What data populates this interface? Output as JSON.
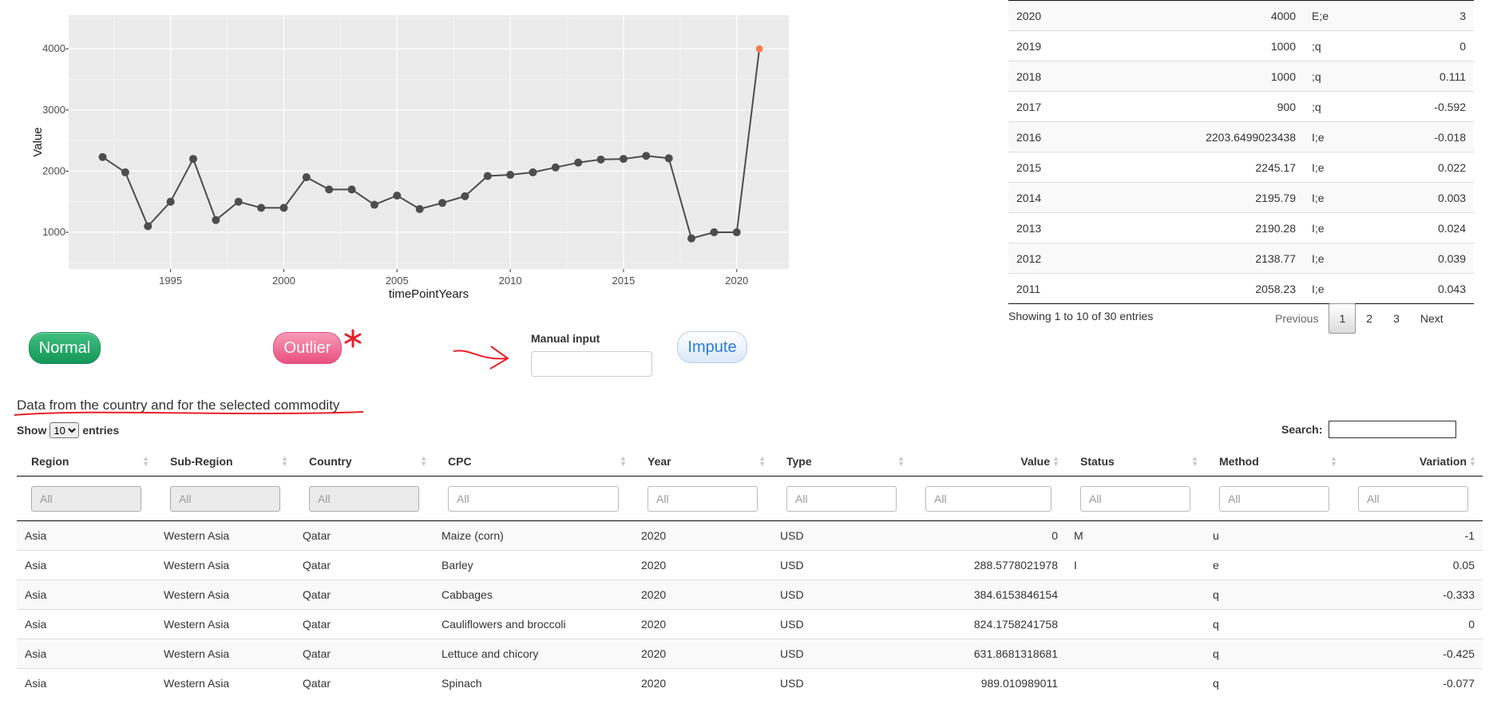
{
  "chart_data": {
    "type": "line",
    "xlabel": "timePointYears",
    "ylabel": "Value",
    "xlim": [
      1990.5,
      2022.3
    ],
    "ylim": [
      400,
      4550
    ],
    "xticks": [
      1995,
      2000,
      2005,
      2010,
      2015,
      2020
    ],
    "yticks": [
      1000,
      2000,
      3000,
      4000
    ],
    "x": [
      1992,
      1993,
      1994,
      1995,
      1996,
      1997,
      1998,
      1999,
      2000,
      2001,
      2002,
      2003,
      2004,
      2005,
      2006,
      2007,
      2008,
      2009,
      2010,
      2011,
      2012,
      2013,
      2014,
      2015,
      2016,
      2017,
      2018,
      2019,
      2020,
      2021
    ],
    "series": [
      {
        "values": [
          2230,
          1980,
          1100,
          1500,
          2200,
          1200,
          1500,
          1400,
          1400,
          1900,
          1700,
          1700,
          1450,
          1600,
          1380,
          1480,
          1590,
          1920,
          1940,
          1980,
          2060,
          2140,
          2190,
          2200,
          2250,
          2210,
          900,
          1000,
          1000,
          4000
        ],
        "highlight_index": 29
      }
    ],
    "grid": true,
    "colors": {
      "line": "#4d4d4d",
      "point": "#4d4d4d",
      "highlight": "#ff7f50",
      "panel": "#ebebeb",
      "gridline": "#ffffff"
    }
  },
  "buttons": {
    "normal": "Normal",
    "outlier": "Outlier",
    "impute": "Impute"
  },
  "manual_input": {
    "label": "Manual input",
    "value": ""
  },
  "top_table": {
    "rows": [
      [
        "2020",
        "4000",
        "E;e",
        "3"
      ],
      [
        "2019",
        "1000",
        ";q",
        "0"
      ],
      [
        "2018",
        "1000",
        ";q",
        "0.111"
      ],
      [
        "2017",
        "900",
        ";q",
        "-0.592"
      ],
      [
        "2016",
        "2203.6499023438",
        "I;e",
        "-0.018"
      ],
      [
        "2015",
        "2245.17",
        "I;e",
        "0.022"
      ],
      [
        "2014",
        "2195.79",
        "I;e",
        "0.003"
      ],
      [
        "2013",
        "2190.28",
        "I;e",
        "0.024"
      ],
      [
        "2012",
        "2138.77",
        "I;e",
        "0.039"
      ],
      [
        "2011",
        "2058.23",
        "I;e",
        "0.043"
      ]
    ],
    "info": "Showing 1 to 10 of 30 entries",
    "pager": {
      "previous": "Previous",
      "pages": [
        "1",
        "2",
        "3"
      ],
      "next": "Next"
    }
  },
  "section_title": "Data from the country and for the selected commodity",
  "length_menu": {
    "show": "Show",
    "value": "10",
    "entries": "entries"
  },
  "search": {
    "label": "Search:",
    "value": ""
  },
  "main_table": {
    "columns": [
      "Region",
      "Sub-Region",
      "Country",
      "CPC",
      "Year",
      "Type",
      "Value",
      "Status",
      "Method",
      "Variation"
    ],
    "filter_placeholder": "All",
    "rows": [
      [
        "Asia",
        "Western Asia",
        "Qatar",
        "Maize (corn)",
        "2020",
        "USD",
        "0",
        "M",
        "u",
        "-1"
      ],
      [
        "Asia",
        "Western Asia",
        "Qatar",
        "Barley",
        "2020",
        "USD",
        "288.5778021978",
        "I",
        "e",
        "0.05"
      ],
      [
        "Asia",
        "Western Asia",
        "Qatar",
        "Cabbages",
        "2020",
        "USD",
        "384.6153846154",
        "",
        "q",
        "-0.333"
      ],
      [
        "Asia",
        "Western Asia",
        "Qatar",
        "Cauliflowers and broccoli",
        "2020",
        "USD",
        "824.1758241758",
        "",
        "q",
        "0"
      ],
      [
        "Asia",
        "Western Asia",
        "Qatar",
        "Lettuce and chicory",
        "2020",
        "USD",
        "631.8681318681",
        "",
        "q",
        "-0.425"
      ],
      [
        "Asia",
        "Western Asia",
        "Qatar",
        "Spinach",
        "2020",
        "USD",
        "989.010989011",
        "",
        "q",
        "-0.077"
      ]
    ]
  }
}
